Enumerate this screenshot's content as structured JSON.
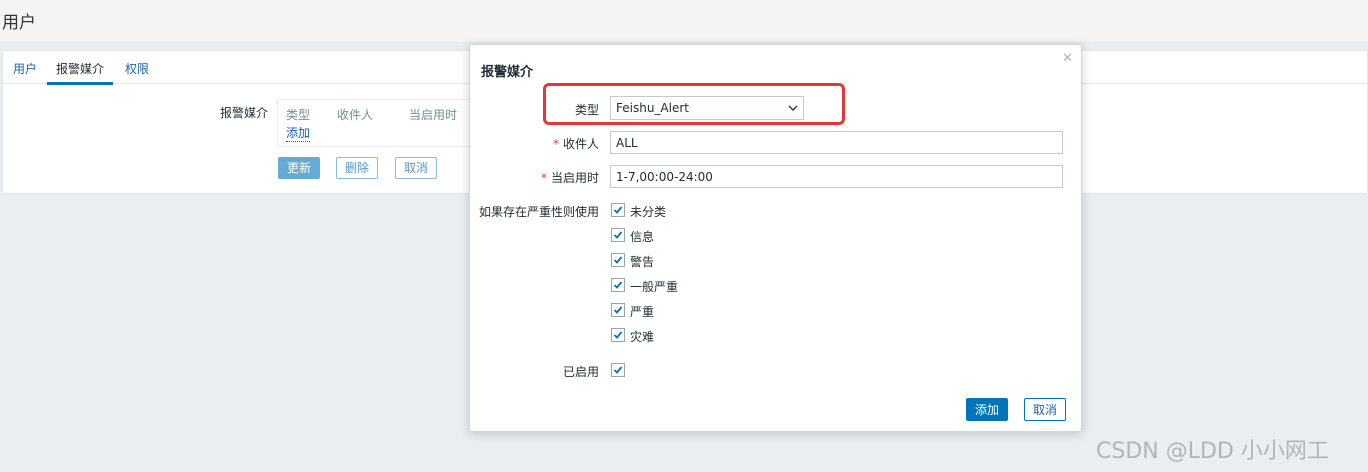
{
  "page": {
    "title": "用户"
  },
  "tabs": [
    {
      "label": "用户"
    },
    {
      "label": "报警媒介"
    },
    {
      "label": "权限"
    }
  ],
  "user_form": {
    "media_label": "报警媒介",
    "table_headers": [
      "类型",
      "收件人",
      "当启用时"
    ],
    "add_link": "添加",
    "update_button": "更新",
    "delete_button": "删除",
    "cancel_button": "取消"
  },
  "dialog": {
    "title": "报警媒介",
    "close_icon": "close-icon",
    "type_label": "类型",
    "type_value": "Feishu_Alert",
    "recipient_label": "收件人",
    "recipient_value": "ALL",
    "period_label": "当启用时",
    "period_value": "1-7,00:00-24:00",
    "severity_label": "如果存在严重性则使用",
    "severities": [
      {
        "label": "未分类",
        "checked": true
      },
      {
        "label": "信息",
        "checked": true
      },
      {
        "label": "警告",
        "checked": true
      },
      {
        "label": "一般严重",
        "checked": true
      },
      {
        "label": "严重",
        "checked": true
      },
      {
        "label": "灾难",
        "checked": true
      }
    ],
    "enabled_label": "已启用",
    "enabled_checked": true,
    "add_button": "添加",
    "cancel_button": "取消"
  },
  "watermark": "CSDN @LDD 小小网工",
  "colors": {
    "accent": "#0275b8",
    "link": "#1f65a6",
    "required": "#e33734",
    "highlight": "#e0383b",
    "background": "#ebeef0"
  }
}
